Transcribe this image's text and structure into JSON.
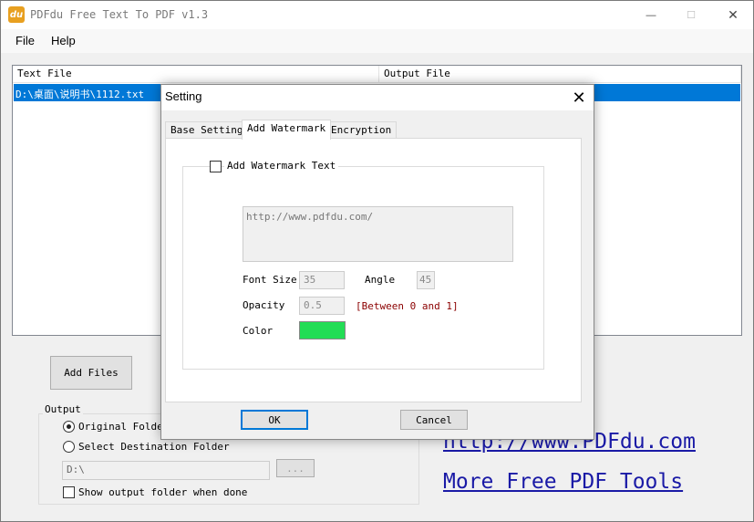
{
  "window": {
    "app_icon_text": "du",
    "title": "PDFdu Free Text To PDF  v1.3",
    "minimize": "—",
    "maximize": "☐",
    "close": "✕"
  },
  "menu": {
    "items": [
      "File",
      "Help"
    ]
  },
  "file_table": {
    "columns": [
      "Text File",
      "Output File"
    ],
    "rows": [
      {
        "text_file": "D:\\桌面\\说明书\\1112.txt",
        "output_file": ""
      }
    ]
  },
  "add_files_button": "Add Files",
  "output": {
    "group_label": "Output",
    "original_folder": "Original Folder",
    "select_destination": "Select Destination Folder",
    "path_value": "D:\\",
    "browse_button": "...",
    "show_output_folder": "Show output folder when done"
  },
  "links": {
    "website": "http://www.PDFdu.com ",
    "more_tools": "More Free PDF Tools"
  },
  "dialog": {
    "title": "Setting",
    "close": "✕",
    "tabs": [
      "Base Setting",
      "Add Watermark",
      "Encryption"
    ],
    "active_tab": "Add Watermark",
    "watermark": {
      "checkbox_label": "Add Watermark Text",
      "text_value": "http://www.pdfdu.com/",
      "font_size_label": "Font Size",
      "font_size_value": "35",
      "angle_label": "Angle",
      "angle_value": "45",
      "opacity_label": "Opacity",
      "opacity_value": "0.5",
      "opacity_hint": "[Between 0 and 1]",
      "color_label": "Color",
      "color_value": "#22dd55"
    },
    "ok_button": "OK",
    "cancel_button": "Cancel"
  },
  "colors": {
    "selection": "#0078d7",
    "hint_red": "#8b0000",
    "link_blue": "#1a1aa6"
  }
}
